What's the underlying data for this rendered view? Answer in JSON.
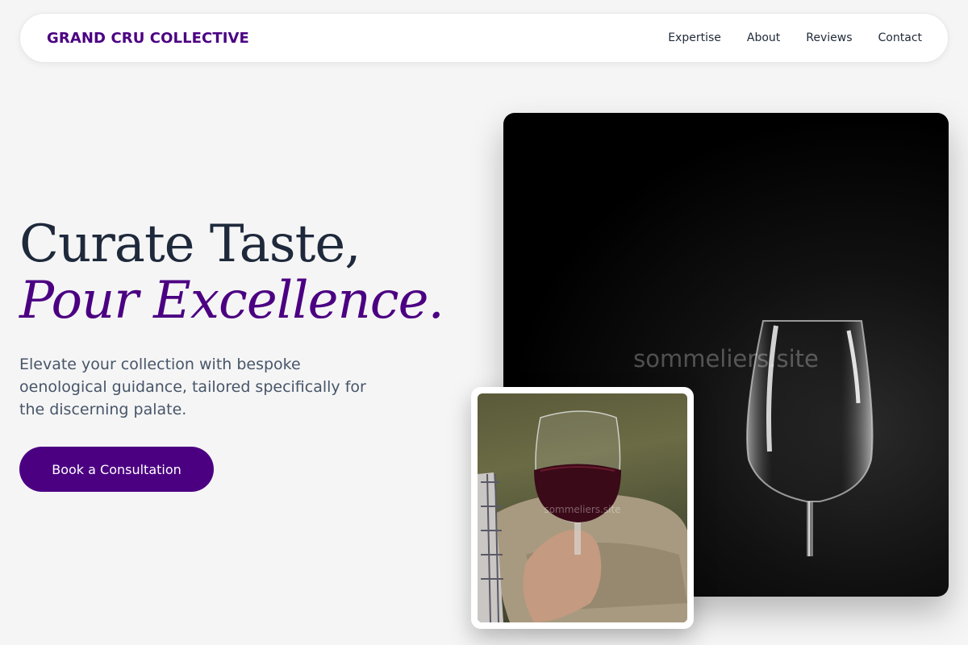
{
  "nav": {
    "brand": "GRAND CRU COLLECTIVE",
    "links": [
      "Expertise",
      "About",
      "Reviews",
      "Contact"
    ]
  },
  "hero": {
    "headline_line1": "Curate Taste,",
    "headline_line2": "Pour Excellence.",
    "subtext": "Elevate your collection with bespoke oenological guidance, tailored specifically for the discerning palate.",
    "cta_label": "Book a Consultation"
  },
  "images": {
    "main_watermark": "sommeliers.site",
    "inset_watermark": "sommeliers.site"
  },
  "colors": {
    "accent": "#4b0082",
    "headline": "#1e293b",
    "body_text": "#475569",
    "background": "#f5f5f5"
  }
}
